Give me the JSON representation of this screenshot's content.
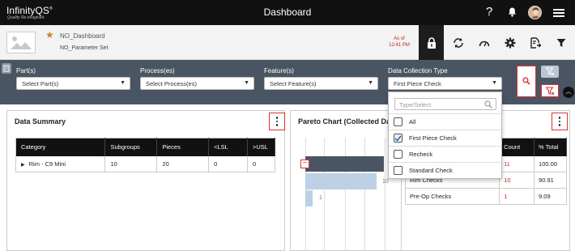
{
  "header": {
    "logo": "InfinityQS",
    "logo_mark": "®",
    "tagline": "Quality Re-imagined",
    "title": "Dashboard"
  },
  "subheader": {
    "dashboard_name": "NO_Dashboard",
    "parameter_set": "NO_Parameter Set",
    "as_of_label": "As of",
    "as_of_time": "12:41 PM"
  },
  "filters": {
    "parts": {
      "label": "Part(s)",
      "value": "Select Part(s)"
    },
    "processes": {
      "label": "Process(es)",
      "value": "Select Process(es)"
    },
    "features": {
      "label": "Feature(s)",
      "value": "Select Feature(s)"
    },
    "collection_type": {
      "label": "Data Collection Type",
      "value": "First Piece Check"
    }
  },
  "dropdown": {
    "search_placeholder": "Type/Select",
    "options": [
      {
        "label": "All",
        "checked": false
      },
      {
        "label": "First Piece Check",
        "checked": true
      },
      {
        "label": "Recheck",
        "checked": false
      },
      {
        "label": "Standard Check",
        "checked": false
      }
    ]
  },
  "data_summary": {
    "title": "Data Summary",
    "columns": [
      "Category",
      "Subgroups",
      "Pieces",
      "<LSL",
      ">USL"
    ],
    "rows": [
      {
        "category": "Rim - C9 Mini",
        "subgroups": "10",
        "pieces": "20",
        "lsl": "0",
        "usl": "0"
      }
    ]
  },
  "pareto": {
    "title": "Pareto Chart (Collected Data",
    "columns": [
      "Count",
      "% Total"
    ],
    "rows": [
      {
        "name": "",
        "count": "11",
        "pct": "100.00"
      },
      {
        "name": "Rim Checks",
        "count": "10",
        "pct": "90.91"
      },
      {
        "name": "Pre-Op Checks",
        "count": "1",
        "pct": "9.09"
      }
    ],
    "bar_labels": [
      "10",
      "1"
    ]
  },
  "colors": {
    "topbar": "#111111",
    "filterbar": "#4a5563",
    "accent_red": "#d33333",
    "star": "#c8862a",
    "bar": "#bcd0e6"
  },
  "icons": [
    "help-icon",
    "bell-icon",
    "avatar",
    "hamburger-icon",
    "lock-icon",
    "refresh-icon",
    "gauge-icon",
    "gear-icon",
    "export-icon",
    "filter-icon",
    "search-icon",
    "clear-filter-icon",
    "alt-filter-icon",
    "chevron-up-icon"
  ]
}
